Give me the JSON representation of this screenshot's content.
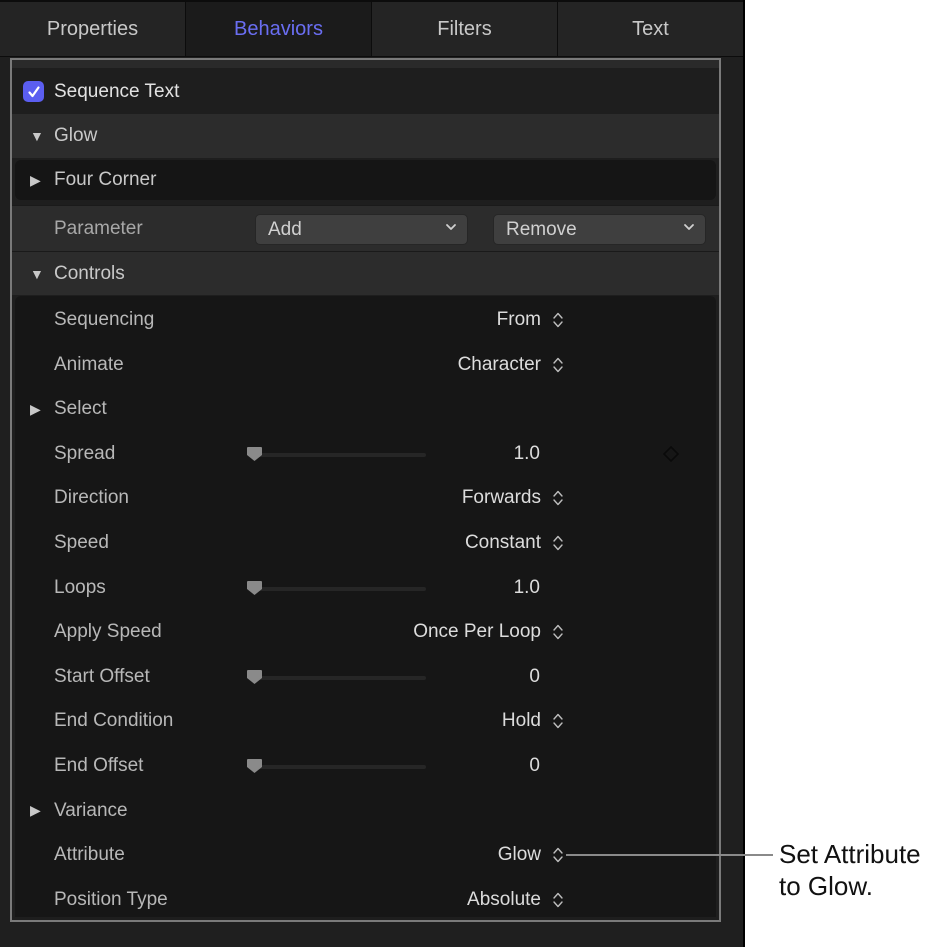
{
  "tabs": [
    {
      "label": "Properties",
      "active": false
    },
    {
      "label": "Behaviors",
      "active": true
    },
    {
      "label": "Filters",
      "active": false
    },
    {
      "label": "Text",
      "active": false
    }
  ],
  "accent_color": "#6a6ef2",
  "behavior": {
    "name": "Sequence Text",
    "enabled": true
  },
  "groups": {
    "glow": {
      "label": "Glow",
      "expanded": true
    },
    "four_corner": {
      "label": "Four Corner",
      "expanded": false
    },
    "parameter": {
      "label": "Parameter",
      "add_label": "Add",
      "remove_label": "Remove"
    },
    "controls": {
      "label": "Controls",
      "expanded": true
    }
  },
  "controls": [
    {
      "label": "Sequencing",
      "type": "popup",
      "value": "From"
    },
    {
      "label": "Animate",
      "type": "popup",
      "value": "Character"
    },
    {
      "label": "Select",
      "type": "disclosure",
      "expanded": false
    },
    {
      "label": "Spread",
      "type": "slider",
      "value": "1.0",
      "slider_fraction": 0.0,
      "keyframe": true
    },
    {
      "label": "Direction",
      "type": "popup",
      "value": "Forwards"
    },
    {
      "label": "Speed",
      "type": "popup",
      "value": "Constant"
    },
    {
      "label": "Loops",
      "type": "slider",
      "value": "1.0",
      "slider_fraction": 0.0
    },
    {
      "label": "Apply Speed",
      "type": "popup",
      "value": "Once Per Loop"
    },
    {
      "label": "Start Offset",
      "type": "slider",
      "value": "0",
      "slider_fraction": 0.0
    },
    {
      "label": "End Condition",
      "type": "popup",
      "value": "Hold"
    },
    {
      "label": "End Offset",
      "type": "slider",
      "value": "0",
      "slider_fraction": 0.0
    },
    {
      "label": "Variance",
      "type": "disclosure",
      "expanded": false
    },
    {
      "label": "Attribute",
      "type": "popup",
      "value": "Glow"
    },
    {
      "label": "Position Type",
      "type": "popup",
      "value": "Absolute"
    }
  ],
  "callout": {
    "line1": "Set Attribute",
    "line2": "to Glow."
  }
}
